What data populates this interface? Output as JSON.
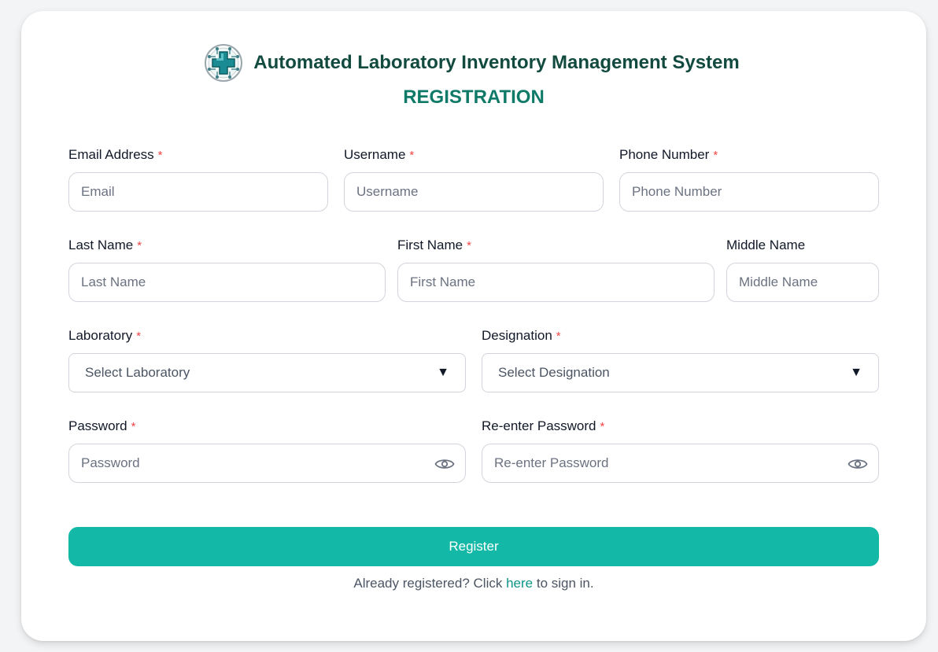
{
  "header": {
    "title": "Automated Laboratory Inventory Management System",
    "subtitle": "REGISTRATION",
    "logo_icon": "medical-circuit-logo-icon"
  },
  "form": {
    "required_marker": "*",
    "email": {
      "label": "Email Address",
      "placeholder": "Email",
      "value": "",
      "required": true
    },
    "username": {
      "label": "Username",
      "placeholder": "Username",
      "value": "",
      "required": true
    },
    "phone": {
      "label": "Phone Number",
      "placeholder": "Phone Number",
      "value": "",
      "required": true
    },
    "last_name": {
      "label": "Last Name",
      "placeholder": "Last Name",
      "value": "",
      "required": true
    },
    "first_name": {
      "label": "First Name",
      "placeholder": "First Name",
      "value": "",
      "required": true
    },
    "middle_name": {
      "label": "Middle Name",
      "placeholder": "Middle Name",
      "value": "",
      "required": false
    },
    "laboratory": {
      "label": "Laboratory",
      "selected": "Select Laboratory",
      "arrow": "▼",
      "required": true
    },
    "designation": {
      "label": "Designation",
      "selected": "Select Designation",
      "arrow": "▼",
      "required": true
    },
    "password": {
      "label": "Password",
      "placeholder": "Password",
      "value": "",
      "required": true,
      "icon": "eye-icon"
    },
    "reenter_password": {
      "label": "Re-enter Password",
      "placeholder": "Re-enter Password",
      "value": "",
      "required": true,
      "icon": "eye-icon"
    }
  },
  "actions": {
    "register_label": "Register",
    "signin_prefix": "Already registered? Click",
    "signin_link": "here",
    "signin_suffix": "to sign in."
  },
  "colors": {
    "accent": "#14b8a6",
    "title": "#124a3f",
    "subtitle": "#0f7a68",
    "required": "#ef4444"
  }
}
